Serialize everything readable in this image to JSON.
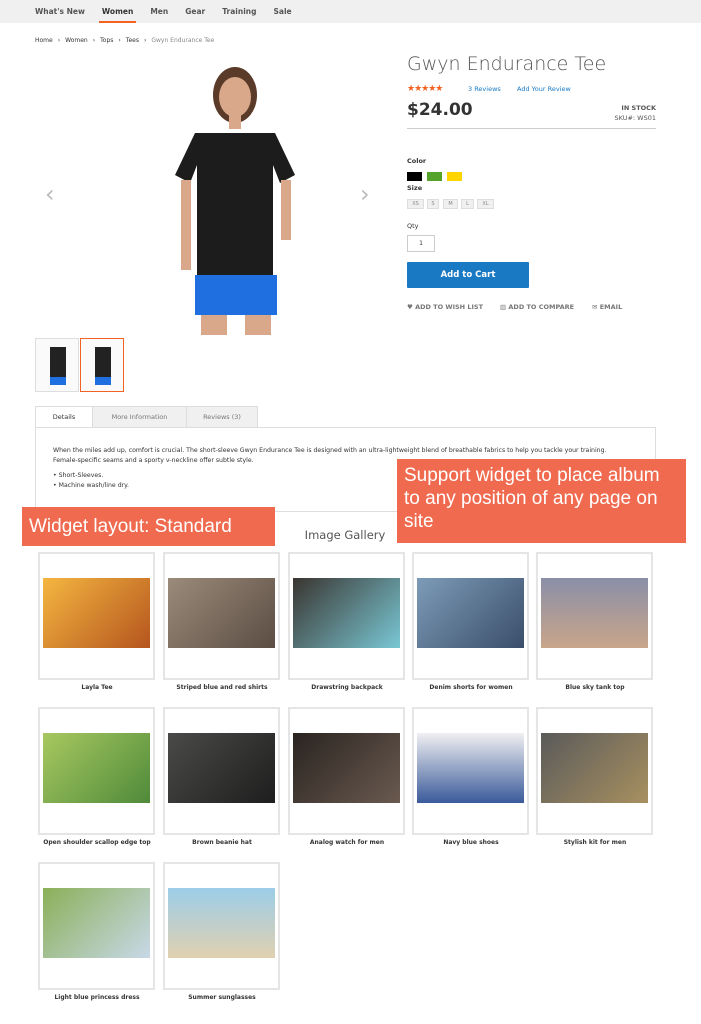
{
  "nav": [
    "What's New",
    "Women",
    "Men",
    "Gear",
    "Training",
    "Sale"
  ],
  "breadcrumb": [
    "Home",
    "Women",
    "Tops",
    "Tees",
    "Gwyn Endurance Tee"
  ],
  "product": {
    "title": "Gwyn Endurance Tee",
    "rating_stars": "★★★★★",
    "rating": 4.5,
    "reviews_link": "3 Reviews",
    "add_review": "Add Your Review",
    "price": "$24.00",
    "stock": "IN STOCK",
    "sku": "SKU#:  WS01",
    "color_label": "Color",
    "colors": [
      "#000000",
      "#53a32a",
      "#ffd500"
    ],
    "size_label": "Size",
    "sizes": [
      "XS",
      "S",
      "M",
      "L",
      "XL"
    ],
    "qty_label": "Qty",
    "qty": "1",
    "add_to_cart": "Add to Cart",
    "actions": [
      "♥ ADD TO WISH LIST",
      "▥ ADD TO COMPARE",
      "✉ EMAIL"
    ]
  },
  "tabs": [
    "Details",
    "More Information",
    "Reviews (3)"
  ],
  "details": {
    "text1": "When the miles add up, comfort is crucial. The short-sleeve Gwyn Endurance Tee is designed with an ultra-lightweight blend of breathable fabrics to help you tackle your training.",
    "text2": "Female-specific seams and a sporty v-neckline offer subtle style.",
    "bullets": [
      "• Short-Sleeves.",
      "• Machine wash/line dry."
    ]
  },
  "callouts": {
    "widget": "Support widget to place album to any position of any page on site",
    "layout": "Widget layout: Standard"
  },
  "gallery": {
    "title": "Image Gallery",
    "items": [
      "Layla Tee",
      "Striped blue and red shirts",
      "Drawstring backpack",
      "Denim shorts for women",
      "Blue sky tank top",
      "Open shoulder scallop edge top",
      "Brown beanie hat",
      "Analog watch for men",
      "Navy blue shoes",
      "Stylish kit for men",
      "Light blue princess dress",
      "Summer sunglasses"
    ]
  }
}
